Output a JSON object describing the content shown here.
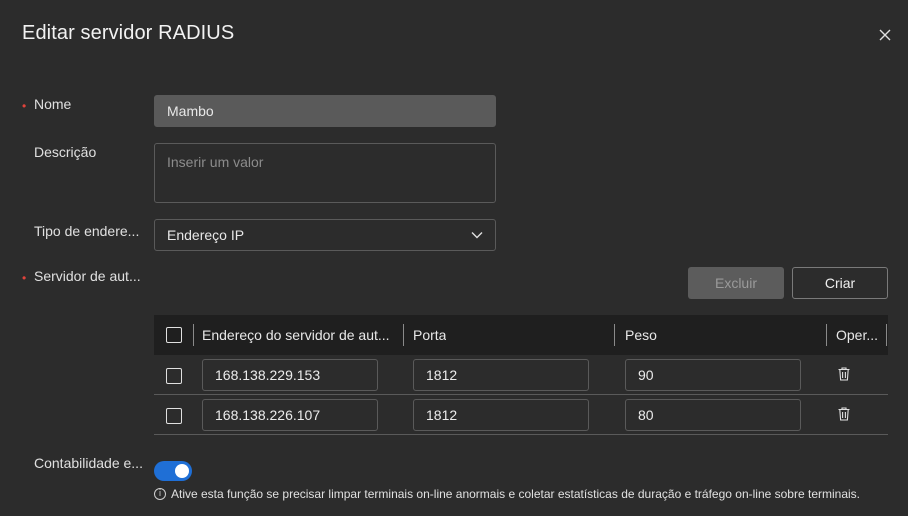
{
  "dialog": {
    "title": "Editar servidor RADIUS"
  },
  "form": {
    "name_label": "Nome",
    "name_value": "Mambo",
    "description_label": "Descrição",
    "description_placeholder": "Inserir um valor",
    "address_type_label": "Tipo de endere...",
    "address_type_value": "Endereço IP",
    "auth_server_label": "Servidor de aut...",
    "accounting_label": "Contabilidade e...",
    "accounting_enabled": true,
    "accounting_hint": "Ative esta função se precisar limpar terminais on-line anormais e coletar estatísticas de duração e tráfego on-line sobre terminais.",
    "hint_icon": "info-icon"
  },
  "toolbar": {
    "delete_label": "Excluir",
    "create_label": "Criar"
  },
  "table": {
    "columns": {
      "address": "Endereço do servidor de aut...",
      "port": "Porta",
      "weight": "Peso",
      "operation": "Oper..."
    },
    "rows": [
      {
        "address": "168.138.229.153",
        "port": "1812",
        "weight": "90"
      },
      {
        "address": "168.138.226.107",
        "port": "1812",
        "weight": "80"
      }
    ]
  },
  "colors": {
    "accent": "#1f6fd6",
    "required": "#e0433b",
    "background": "#2c2c2c"
  }
}
